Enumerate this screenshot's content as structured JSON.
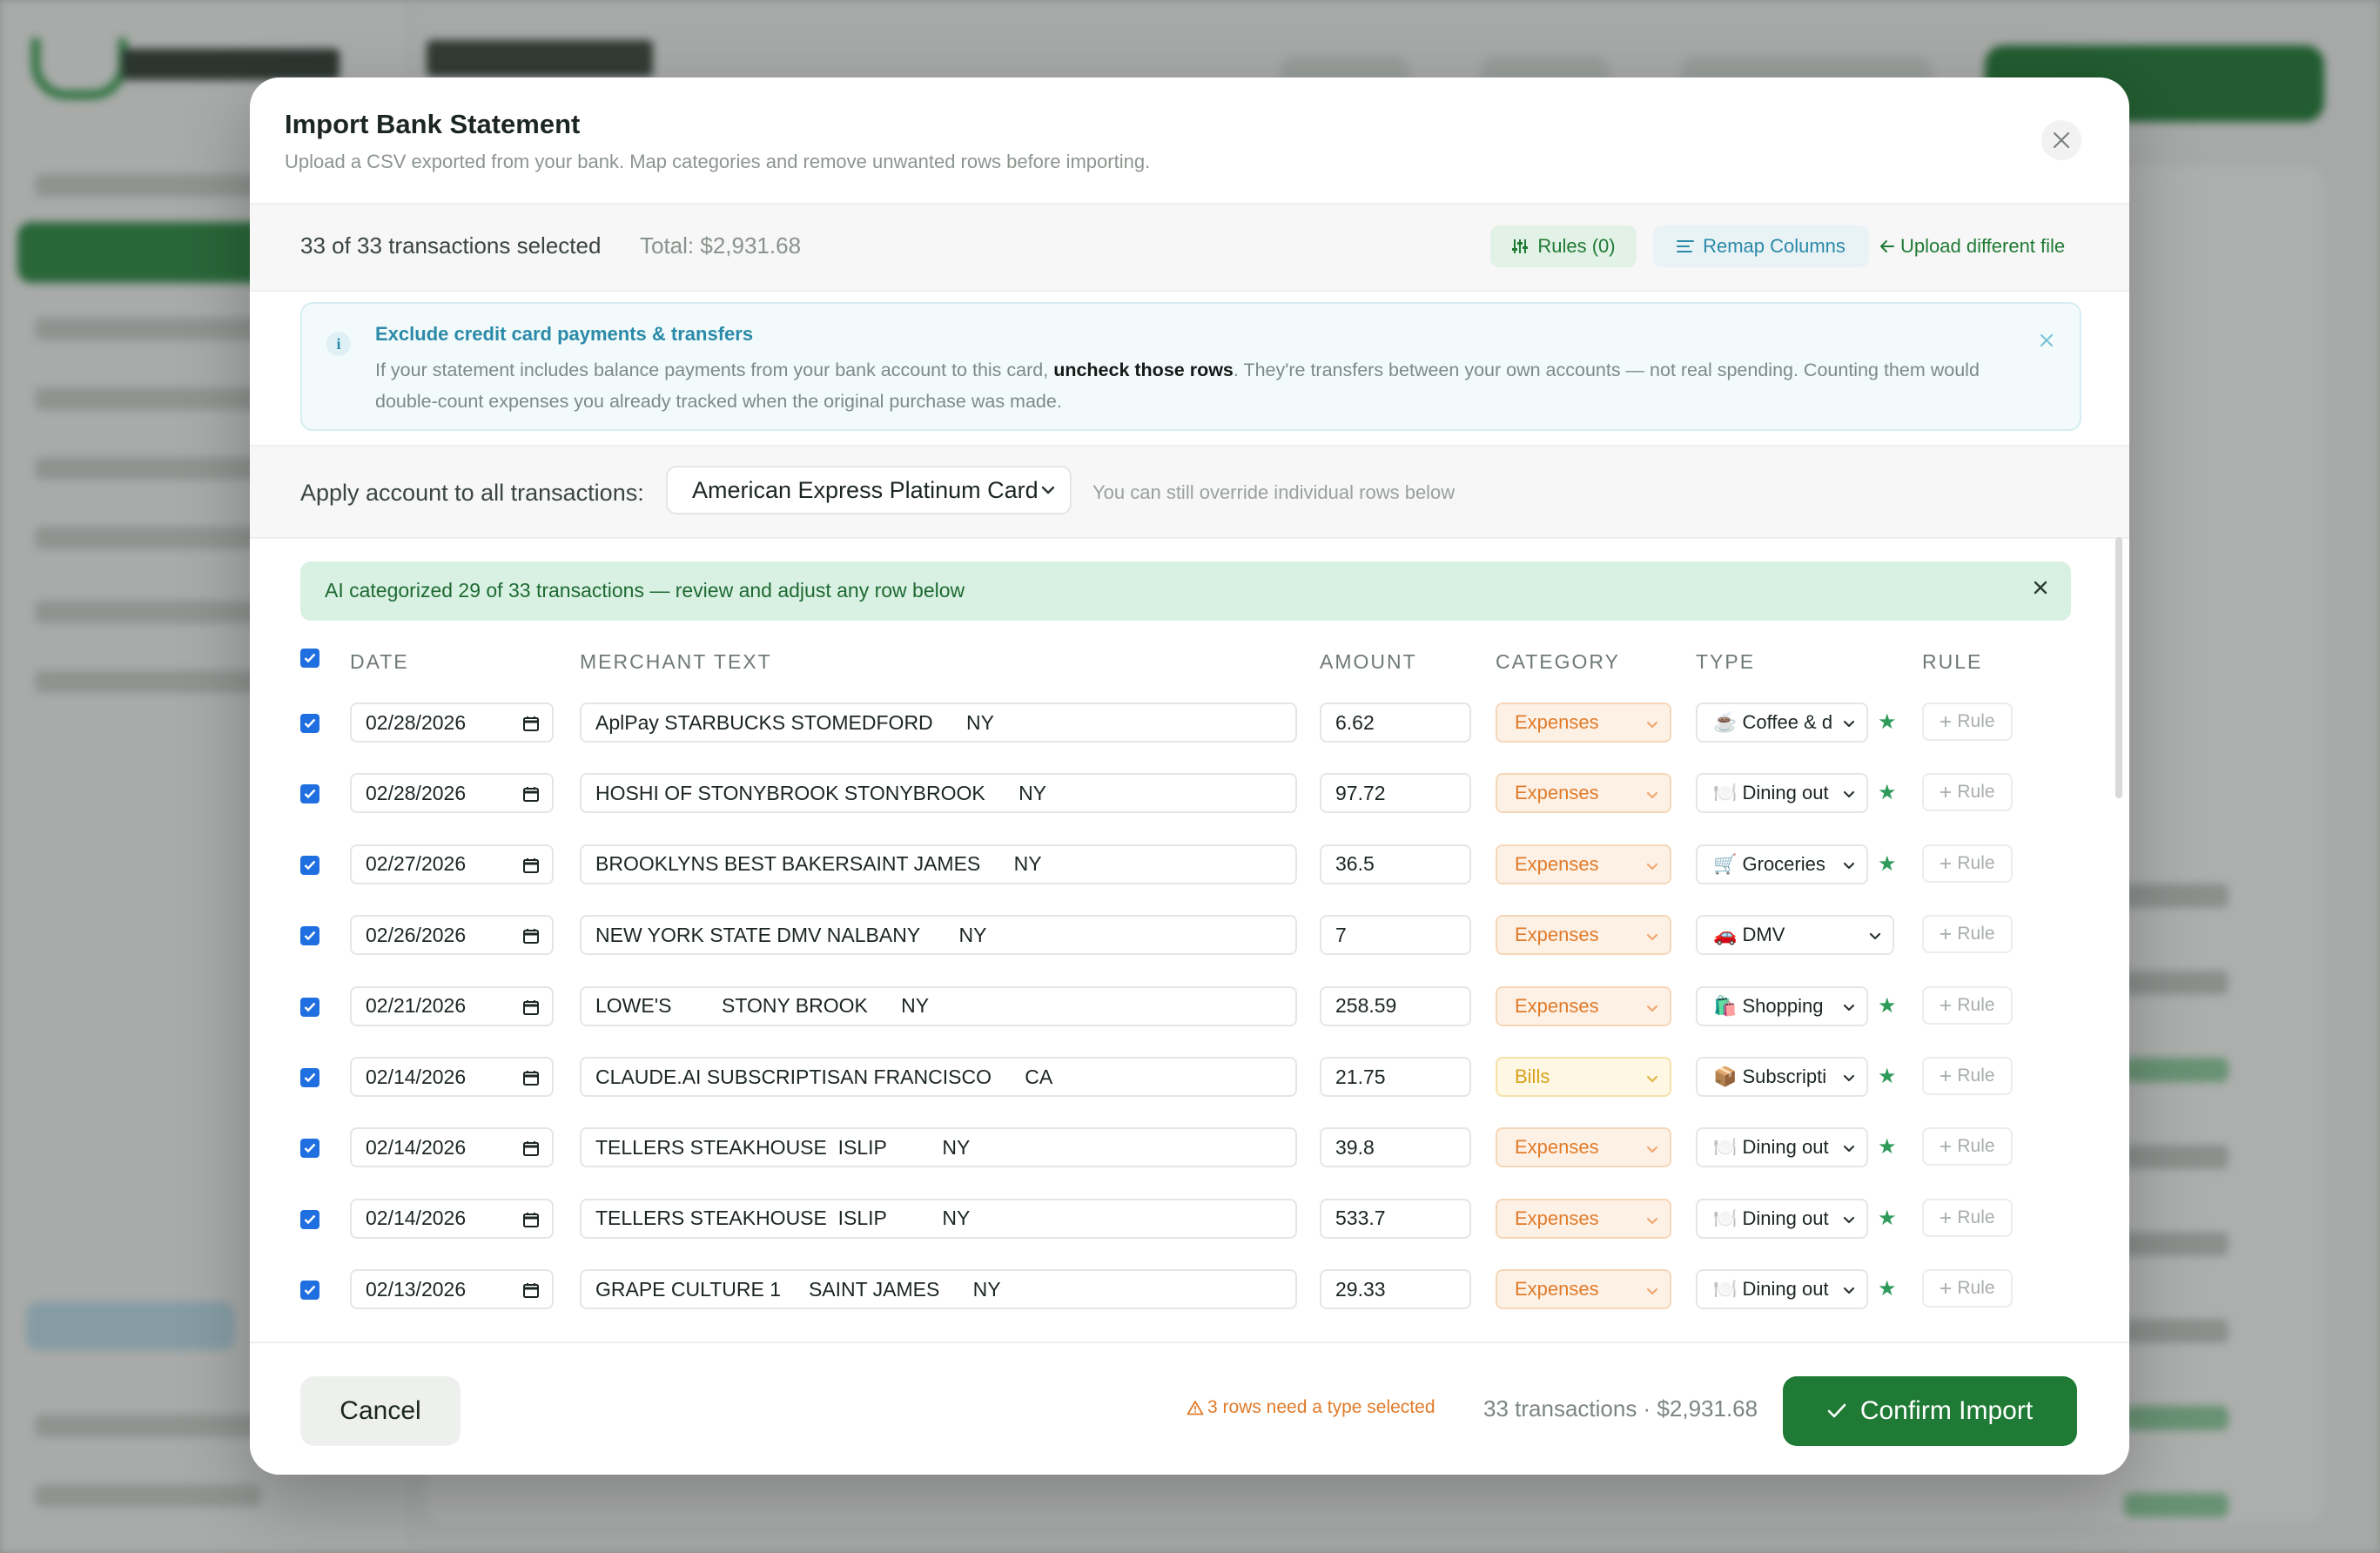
{
  "modal": {
    "title": "Import Bank Statement",
    "subtitle": "Upload a CSV exported from your bank. Map categories and remove unwanted rows before importing."
  },
  "toolbar": {
    "selected_text": "33 of 33 transactions selected",
    "total_text": "Total: $2,931.68",
    "rules_label": "Rules (0)",
    "remap_label": "Remap Columns",
    "upload_label": "Upload different file"
  },
  "info": {
    "heading": "Exclude credit card payments & transfers",
    "text_before": "If your statement includes balance payments from your bank account to this card, ",
    "text_bold": "uncheck those rows",
    "text_after": ". They're transfers between your own accounts — not real spending. Counting them would double-count expenses you already tracked when the original purchase was made."
  },
  "account": {
    "label": "Apply account to all transactions:",
    "selected": "American Express Platinum Card",
    "hint": "You can still override individual rows below"
  },
  "ai_banner": "AI categorized 29 of 33 transactions — review and adjust any row below",
  "columns": {
    "date": "DATE",
    "merchant": "MERCHANT TEXT",
    "amount": "AMOUNT",
    "category": "CATEGORY",
    "type": "TYPE",
    "rule": "RULE"
  },
  "rows": [
    {
      "date": "02/28/2026",
      "merchant": "AplPay STARBUCKS STOMEDFORD      NY",
      "amount": "6.62",
      "category": "Expenses",
      "type": "☕ Coffee & d",
      "starred": true
    },
    {
      "date": "02/28/2026",
      "merchant": "HOSHI OF STONYBROOK STONYBROOK      NY",
      "amount": "97.72",
      "category": "Expenses",
      "type": "🍽️ Dining out",
      "starred": true
    },
    {
      "date": "02/27/2026",
      "merchant": "BROOKLYNS BEST BAKERSAINT JAMES      NY",
      "amount": "36.5",
      "category": "Expenses",
      "type": "🛒 Groceries",
      "starred": true
    },
    {
      "date": "02/26/2026",
      "merchant": "NEW YORK STATE DMV NALBANY       NY",
      "amount": "7",
      "category": "Expenses",
      "type": "🚗 DMV",
      "starred": false
    },
    {
      "date": "02/21/2026",
      "merchant": "LOWE'S         STONY BROOK      NY",
      "amount": "258.59",
      "category": "Expenses",
      "type": "🛍️ Shopping",
      "starred": true
    },
    {
      "date": "02/14/2026",
      "merchant": "CLAUDE.AI SUBSCRIPTISAN FRANCISCO      CA",
      "amount": "21.75",
      "category": "Bills",
      "type": "📦 Subscripti",
      "starred": true
    },
    {
      "date": "02/14/2026",
      "merchant": "TELLERS STEAKHOUSE  ISLIP          NY",
      "amount": "39.8",
      "category": "Expenses",
      "type": "🍽️ Dining out",
      "starred": true
    },
    {
      "date": "02/14/2026",
      "merchant": "TELLERS STEAKHOUSE  ISLIP          NY",
      "amount": "533.7",
      "category": "Expenses",
      "type": "🍽️ Dining out",
      "starred": true
    },
    {
      "date": "02/13/2026",
      "merchant": "GRAPE CULTURE 1     SAINT JAMES      NY",
      "amount": "29.33",
      "category": "Expenses",
      "type": "🍽️ Dining out",
      "starred": true
    }
  ],
  "rule_button_label": "Rule",
  "footer": {
    "cancel": "Cancel",
    "warning": "3 rows need a type selected",
    "summary": "33 transactions · $2,931.68",
    "confirm": "Confirm Import"
  },
  "colors": {
    "primary_green": "#1f7a35",
    "info_blue": "#2a8aa8",
    "warning_orange": "#e07b2a",
    "bills_yellow": "#d9a21a",
    "checkbox_blue": "#1f6fe0"
  }
}
